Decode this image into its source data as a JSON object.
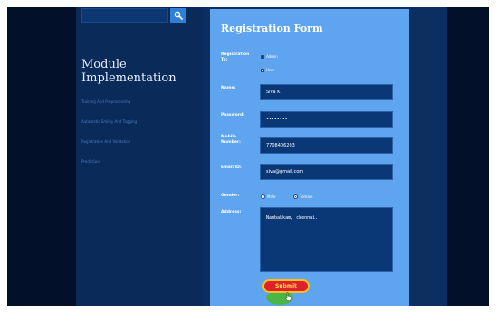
{
  "sidebar": {
    "search": {
      "placeholder": ""
    },
    "module_title": "Module Implementation",
    "menu": [
      "Training And Preprocessing",
      "Automatic Smiley And Tagging",
      "Registration And Validation",
      "Prediction"
    ]
  },
  "form": {
    "title": "Registration Form",
    "registration_to": {
      "label": "Registration To:",
      "options": [
        {
          "label": "Admin",
          "checked": true
        },
        {
          "label": "User",
          "checked": false
        }
      ]
    },
    "name": {
      "label": "Name:",
      "value": "Siva K"
    },
    "password": {
      "label": "Password:",
      "value": "••••••••"
    },
    "mobile": {
      "label": "Mobile Number:",
      "value": "7708406203"
    },
    "email": {
      "label": "Email ID:",
      "value": "siva@gmail.com"
    },
    "gender": {
      "label": "Gender:",
      "options": [
        {
          "label": "Male",
          "checked": false
        },
        {
          "label": "Female",
          "checked": true
        }
      ]
    },
    "address": {
      "label": "Address:",
      "value": "Nambakkam, chennai."
    },
    "submit_label": "Submit"
  },
  "colors": {
    "page_bg": "#031534",
    "sidebar_bg": "#0a2b5a",
    "form_bg": "#5fa4ee",
    "field_bg": "#0a3877",
    "submit_bg": "#e0212b",
    "submit_text": "#ffe24a"
  },
  "icons": {
    "search": "search-icon",
    "cursor": "hand-cursor-icon"
  }
}
